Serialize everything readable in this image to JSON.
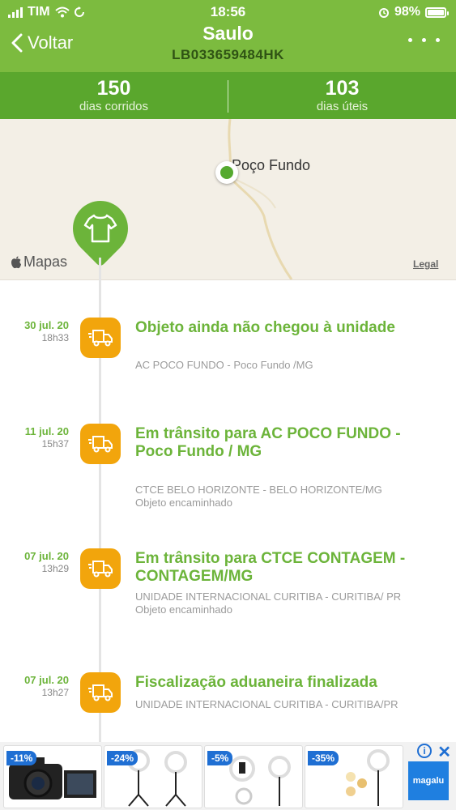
{
  "status_bar": {
    "carrier": "TIM",
    "time": "18:56",
    "battery": "98%"
  },
  "header": {
    "back_label": "Voltar",
    "title": "Saulo",
    "tracking_code": "LB033659484HK"
  },
  "stats": [
    {
      "value": "150",
      "label": "dias corridos"
    },
    {
      "value": "103",
      "label": "dias úteis"
    }
  ],
  "map": {
    "city": "Poço Fundo",
    "brand": "Mapas",
    "legal": "Legal"
  },
  "events": [
    {
      "date": "30 jul. 20",
      "time": "18h33",
      "title": "Objeto ainda não chegou à unidade",
      "details": "AC POCO FUNDO - Poco Fundo                    /MG"
    },
    {
      "date": "11 jul. 20",
      "time": "15h37",
      "title": "Em trânsito para AC POCO FUNDO - Poco Fundo                          / MG",
      "details": "CTCE BELO HORIZONTE - BELO HORIZONTE/MG Objeto encaminhado"
    },
    {
      "date": "07 jul. 20",
      "time": "13h29",
      "title": "Em trânsito para CTCE CONTAGEM - CONTAGEM/MG",
      "details": "UNIDADE INTERNACIONAL CURITIBA - CURITIBA/ PR Objeto encaminhado"
    },
    {
      "date": "07 jul. 20",
      "time": "13h27",
      "title": "Fiscalização aduaneira finalizada",
      "details": "UNIDADE INTERNACIONAL CURITIBA - CURITIBA/PR"
    }
  ],
  "ads": {
    "discounts": [
      "-11%",
      "-24%",
      "-5%",
      "-35%"
    ],
    "brand": "magalu"
  }
}
